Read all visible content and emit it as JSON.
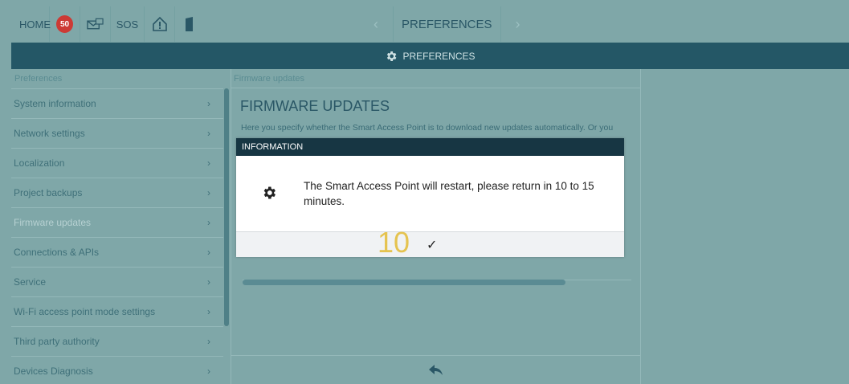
{
  "topbar": {
    "home_label": "HOME",
    "badge_count": "50",
    "sos_label": "SOS",
    "title": "PREFERENCES",
    "prev_arrow": "‹",
    "next_arrow": "›"
  },
  "header": {
    "label": "PREFERENCES",
    "icon": "gear-icon"
  },
  "sidebar": {
    "title": "Preferences",
    "items": [
      {
        "label": "System information",
        "active": false
      },
      {
        "label": "Network settings",
        "active": false
      },
      {
        "label": "Localization",
        "active": false
      },
      {
        "label": "Project backups",
        "active": false
      },
      {
        "label": "Firmware updates",
        "active": true
      },
      {
        "label": "Connections & APIs",
        "active": false
      },
      {
        "label": "Service",
        "active": false
      },
      {
        "label": "Wi-Fi access point mode settings",
        "active": false
      },
      {
        "label": "Third party authority",
        "active": false
      },
      {
        "label": "Devices Diagnosis",
        "active": false
      }
    ],
    "chevron": "›"
  },
  "content": {
    "breadcrumb": "Firmware updates",
    "heading": "FIRMWARE UPDATES",
    "description": "Here you specify whether the Smart Access Point is to download new updates automatically. Or you",
    "progress": 0.83
  },
  "modal": {
    "title": "INFORMATION",
    "message": "The Smart Access Point will restart, please return in 10 to 15 minutes.",
    "countdown": "10",
    "confirm_symbol": "✓"
  },
  "colors": {
    "background": "#7fa7a8",
    "header": "#245766",
    "modal_header": "#173643",
    "badge": "#cc3a35",
    "countdown": "#e5c34f"
  }
}
